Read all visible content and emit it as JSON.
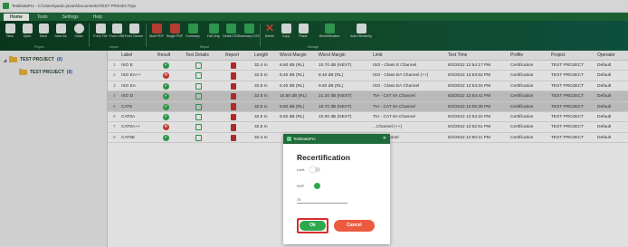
{
  "window": {
    "title": "TestDataPro - C:\\Users\\paolo.jovani\\Documents\\TEST PROJECT.tpx"
  },
  "ribbon": {
    "tabs": [
      "Home",
      "Tools",
      "Settings",
      "Help"
    ],
    "buttons": [
      {
        "label": "New",
        "icon": "new-file-icon"
      },
      {
        "label": "Open",
        "icon": "open-folder-icon"
      },
      {
        "label": "Save",
        "icon": "save-icon"
      },
      {
        "label": "Save As",
        "icon": "save-as-icon"
      },
      {
        "label": "Close",
        "icon": "close-circle-icon"
      },
      {
        "label": "From File",
        "icon": "import-file-icon"
      },
      {
        "label": "From USB",
        "icon": "usb-icon"
      },
      {
        "label": "From Device",
        "icon": "device-icon"
      },
      {
        "label": "Multi PDF",
        "icon": "pdf-icon"
      },
      {
        "label": "Single PDF",
        "icon": "pdf-icon"
      },
      {
        "label": "Summary",
        "icon": "summary-icon"
      },
      {
        "label": "Fail Only",
        "icon": "fail-filter-icon"
      },
      {
        "label": "Detail CSV",
        "icon": "csv-icon"
      },
      {
        "label": "Summary CSV",
        "icon": "csv-icon"
      },
      {
        "label": "Delete",
        "icon": "delete-x-icon"
      },
      {
        "label": "Copy",
        "icon": "copy-icon"
      },
      {
        "label": "Paste",
        "icon": "paste-icon"
      },
      {
        "label": "Recertification",
        "icon": "recertification-icon"
      },
      {
        "label": "Auto Hierarchy",
        "icon": "hierarchy-icon"
      }
    ],
    "groups": [
      "Project",
      "Import",
      "Report",
      "Manage"
    ]
  },
  "tree": {
    "items": [
      {
        "label": "TEST PROJECT",
        "count": "(8)"
      },
      {
        "label": "TEST PROJECT",
        "count": "(8)"
      }
    ]
  },
  "table": {
    "headers": [
      "",
      "Label",
      "Result",
      "Test Details",
      "Report",
      "Length",
      "Worst Margin",
      "Worst Margin",
      "Limit",
      "Test Time",
      "Profile",
      "Project",
      "Operator"
    ],
    "rows": [
      {
        "num": "1",
        "label": "ISO E",
        "result": "pass",
        "length": "32.4 m",
        "wm1": "8.60 dB (RL)",
        "wm2": "10.70 dB (NEXT)",
        "limit": "ISO - Class E Channel",
        "time": "8/3/2022 12:54:17 PM",
        "profile": "Certification",
        "project": "TEST PROJECT",
        "operator": "Default"
      },
      {
        "num": "2",
        "label": "ISO EA++",
        "result": "fail",
        "length": "32.5 m",
        "wm1": "8.40 dB (RL)",
        "wm2": "8.40 dB (RL)",
        "limit": "ISO - Class EA Channel (++)",
        "time": "8/3/2022 12:53:52 PM",
        "profile": "Certification",
        "project": "TEST PROJECT",
        "operator": "Default"
      },
      {
        "num": "3",
        "label": "ISO EA",
        "result": "pass",
        "length": "32.5 m",
        "wm1": "8.40 dB (RL)",
        "wm2": "9.50 dB (RL)",
        "limit": "ISO - Class EA Channel",
        "time": "8/3/2022 12:53:24 PM",
        "profile": "Certification",
        "project": "TEST PROJECT",
        "operator": "Default"
      },
      {
        "num": "4",
        "label": "ISO D",
        "result": "pass",
        "length": "32.5 m",
        "wm1": "10.50 dB (RL)",
        "wm2": "21.20 dB (NEXT)",
        "limit": "TIA - CAT 5A Channel",
        "time": "8/3/2022 12:54:41 PM",
        "profile": "Certification",
        "project": "TEST PROJECT",
        "operator": "Default"
      },
      {
        "num": "5",
        "label": "CAT6",
        "result": "pass",
        "length": "32.5 m",
        "wm1": "8.50 dB (RL)",
        "wm2": "10.70 dB (NEXT)",
        "limit": "TIA - CAT 6A Channel",
        "time": "8/3/2022 12:55:35 PM",
        "profile": "Certification",
        "project": "TEST PROJECT",
        "operator": "Default"
      },
      {
        "num": "6",
        "label": "CAT6A",
        "result": "pass",
        "length": "32.5 m",
        "wm1": "8.50 dB (RL)",
        "wm2": "10.00 dB (NEXT)",
        "limit": "TIA - CAT 6A Channel",
        "time": "8/3/2022 12:52:24 PM",
        "profile": "Certification",
        "project": "TEST PROJECT",
        "operator": "Default"
      },
      {
        "num": "7",
        "label": "CAT6A++",
        "result": "fail",
        "length": "32.5 m",
        "wm1": "",
        "wm2": "",
        "limit": "...Channel (++)",
        "time": "8/3/2022 12:52:51 PM",
        "profile": "Certification",
        "project": "TEST PROJECT",
        "operator": "Default"
      },
      {
        "num": "8",
        "label": "CAT6E",
        "result": "pass",
        "length": "32.4 m",
        "wm1": "",
        "wm2": "",
        "limit": "...5e Channel",
        "time": "8/3/2022 12:50:11 PM",
        "profile": "Certification",
        "project": "TEST PROJECT",
        "operator": "Default"
      }
    ]
  },
  "dialog": {
    "window_title": "TestDataPro",
    "heading": "Recertification",
    "label_limit": "Limit",
    "label_nvp": "NVP",
    "field_value": "70",
    "ok_label": "Ok",
    "cancel_label": "Cancel"
  },
  "colors": {
    "accent_green": "#1f6b3a",
    "pass_green": "#2ea84f",
    "fail_red": "#d8402f",
    "cancel_orange": "#ec5a3f"
  }
}
